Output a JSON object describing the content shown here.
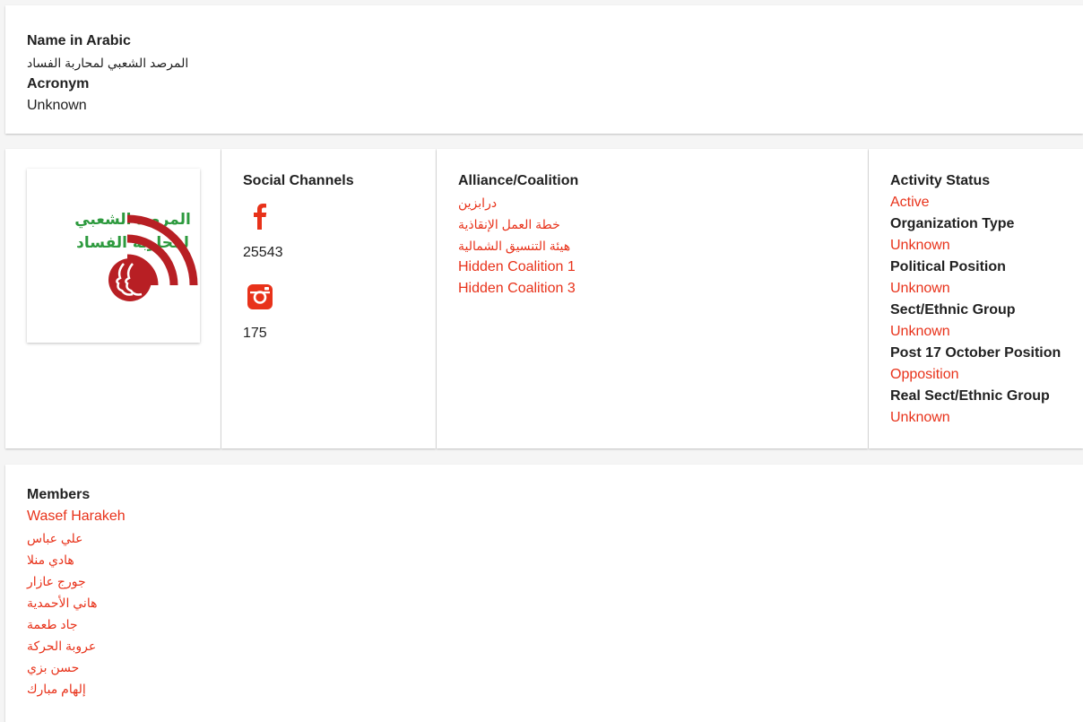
{
  "colors": {
    "accent": "#e8321a",
    "logo_green": "#2d9a3e",
    "logo_red": "#b81f24"
  },
  "identity": {
    "name_arabic_label": "Name in Arabic",
    "name_arabic_value": "المرصد الشعبي لمحاربة الفساد",
    "acronym_label": "Acronym",
    "acronym_value": "Unknown"
  },
  "logo": {
    "line1": "المرصد الشعبي",
    "line2": "لمحاربة الفساد"
  },
  "social": {
    "title": "Social Channels",
    "channels": [
      {
        "icon": "facebook-icon",
        "count": "25543"
      },
      {
        "icon": "instagram-icon",
        "count": "175"
      }
    ]
  },
  "alliance": {
    "title": "Alliance/Coalition",
    "items": [
      "درابزين",
      "خطة العمل الإنقاذية",
      "هيئة التنسيق الشمالية",
      "Hidden Coalition 1",
      "Hidden Coalition 3"
    ]
  },
  "status": {
    "activity_label": "Activity Status",
    "activity_value": "Active",
    "org_type_label": "Organization Type",
    "org_type_value": "Unknown",
    "political_label": "Political Position",
    "political_value": "Unknown",
    "sect_label": "Sect/Ethnic Group",
    "sect_value": "Unknown",
    "post17_label": "Post 17 October Position",
    "post17_value": "Opposition",
    "real_sect_label": "Real Sect/Ethnic Group",
    "real_sect_value": "Unknown"
  },
  "members": {
    "title": "Members",
    "items": [
      "Wasef Harakeh",
      "علي عباس",
      "هادي منلا",
      "جورج عازار",
      "هاني الأحمدية",
      "جاد طعمة",
      "عروبة الحركة",
      "حسن بزي",
      "إلهام مبارك"
    ]
  }
}
